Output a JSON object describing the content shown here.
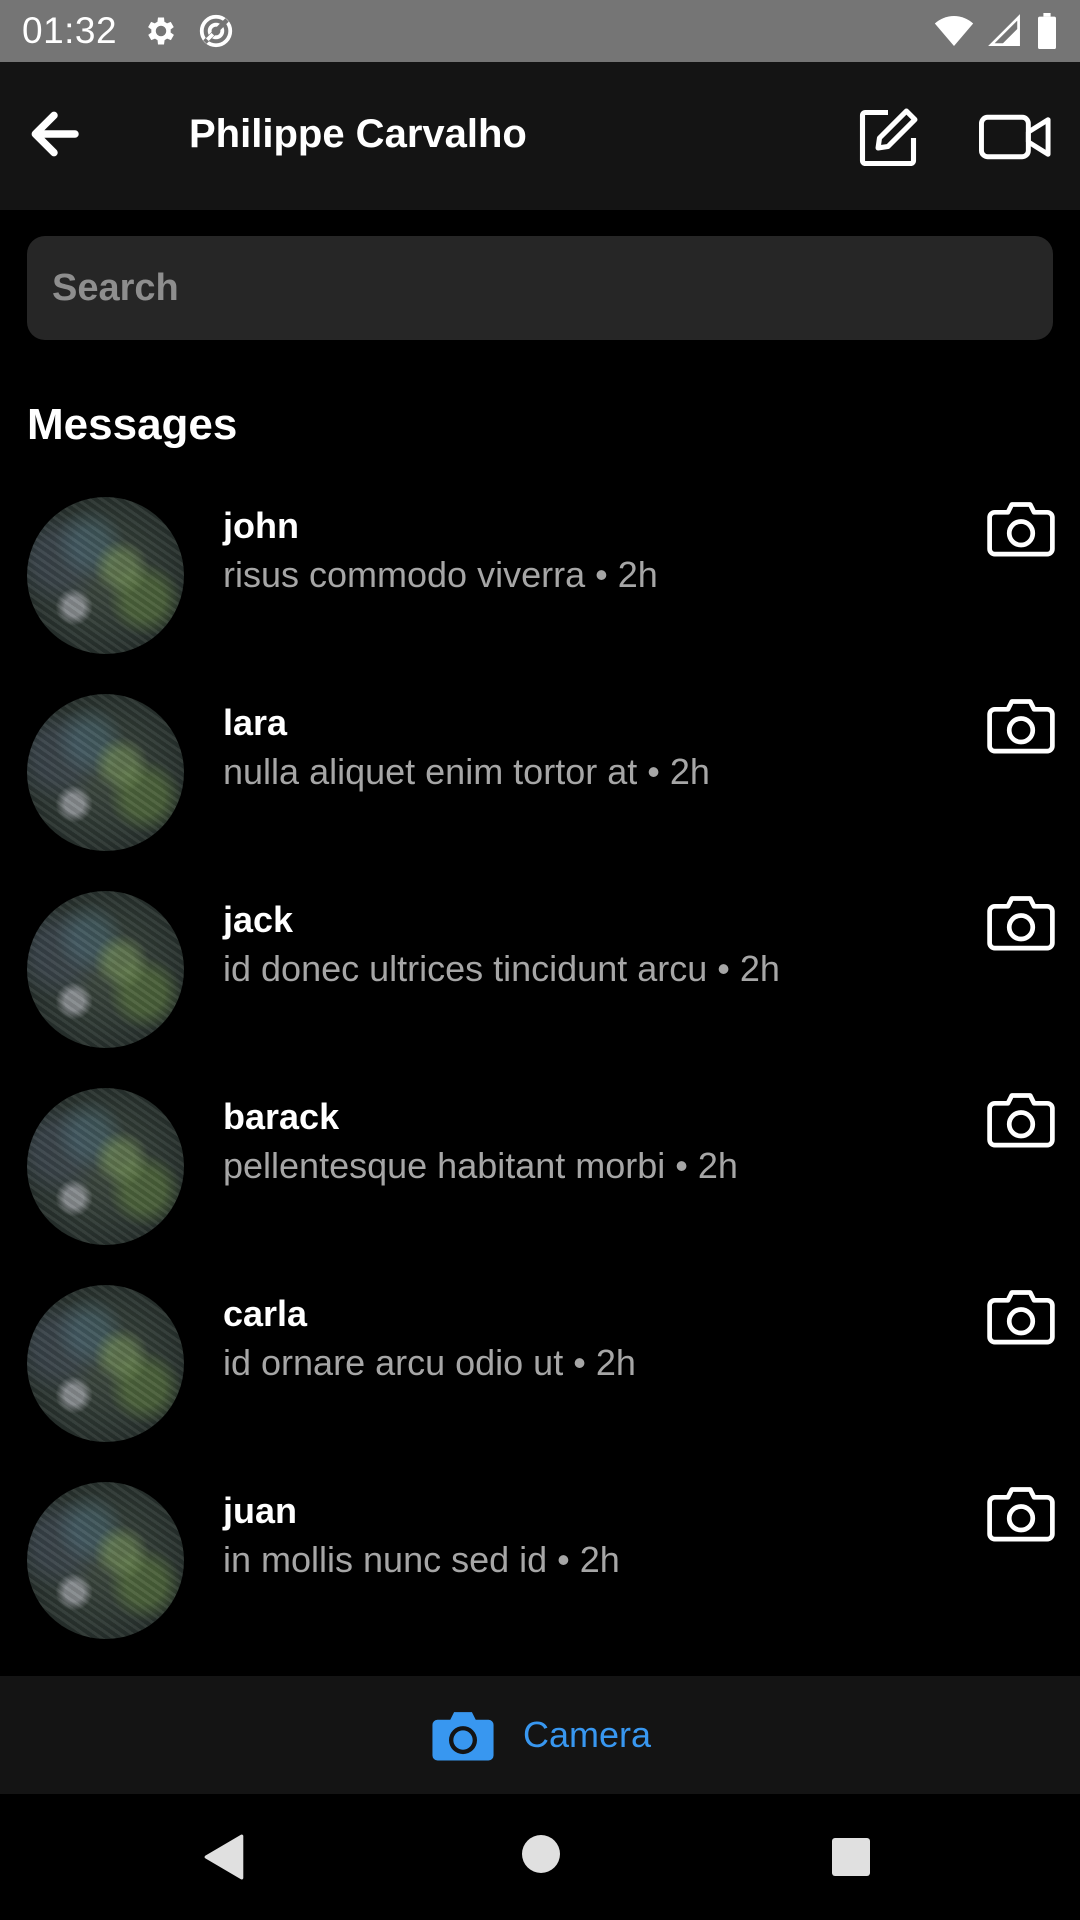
{
  "status_bar": {
    "time": "01:32",
    "icons": [
      "settings-gear-icon",
      "data-saver-icon",
      "wifi-icon",
      "cell-signal-icon",
      "battery-icon"
    ]
  },
  "app_bar": {
    "title": "Philippe Carvalho",
    "icons": [
      "back-arrow-icon",
      "compose-icon",
      "video-camera-icon"
    ]
  },
  "search": {
    "placeholder": "Search",
    "value": ""
  },
  "messages_section": {
    "title": "Messages"
  },
  "conversations": [
    {
      "name": "john",
      "preview": "risus commodo viverra • 2h"
    },
    {
      "name": "lara",
      "preview": "nulla aliquet enim tortor at • 2h"
    },
    {
      "name": "jack",
      "preview": "id donec ultrices tincidunt arcu • 2h"
    },
    {
      "name": "barack",
      "preview": "pellentesque habitant morbi • 2h"
    },
    {
      "name": "carla",
      "preview": "id ornare arcu odio ut • 2h"
    },
    {
      "name": "juan",
      "preview": "in mollis nunc sed id • 2h"
    }
  ],
  "bottom_bar": {
    "camera_label": "Camera",
    "accent_color": "#3897f0"
  },
  "nav_bar": {
    "icons": [
      "nav-back-icon",
      "nav-home-icon",
      "nav-recents-icon"
    ]
  }
}
